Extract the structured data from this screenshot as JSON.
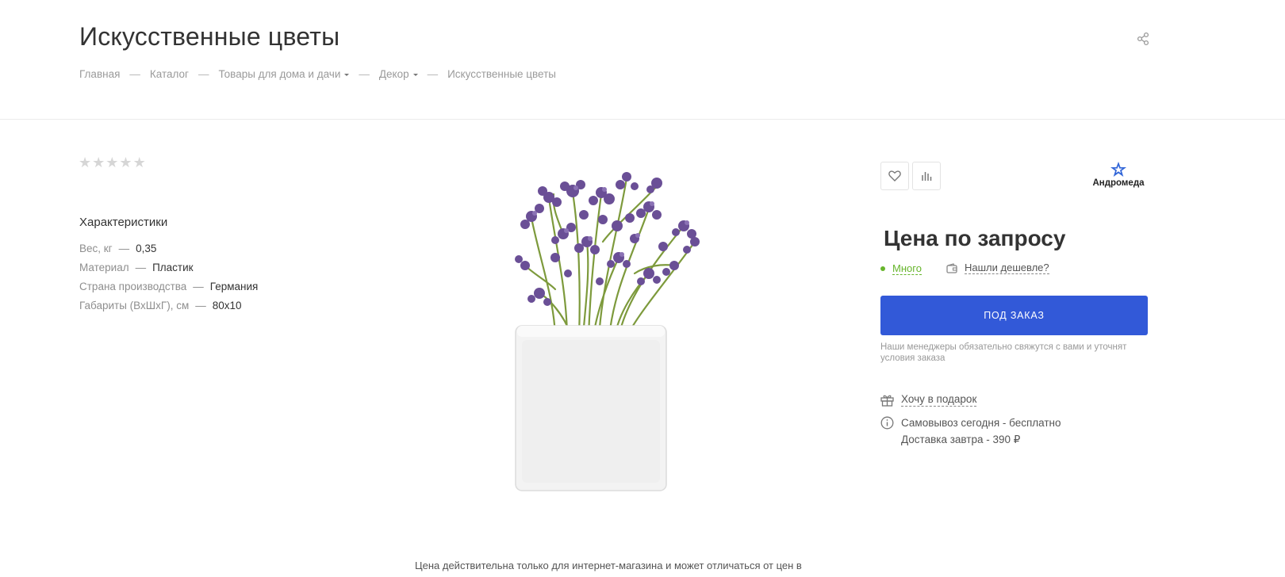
{
  "page": {
    "title": "Искусственные цветы"
  },
  "breadcrumb": [
    {
      "label": "Главная",
      "has_dropdown": false
    },
    {
      "label": "Каталог",
      "has_dropdown": false
    },
    {
      "label": "Товары для дома и дачи",
      "has_dropdown": true
    },
    {
      "label": "Декор",
      "has_dropdown": true
    },
    {
      "label": "Искусственные цветы",
      "has_dropdown": false
    }
  ],
  "breadcrumb_separator": "—",
  "rating": {
    "stars_filled": 0,
    "stars_total": 5,
    "star_glyph": "★"
  },
  "specs": {
    "title": "Характеристики",
    "separator": "—",
    "items": [
      {
        "name": "Вес, кг",
        "value": "0,35"
      },
      {
        "name": "Материал",
        "value": "Пластик"
      },
      {
        "name": "Страна производства",
        "value": "Германия"
      },
      {
        "name": "Габариты (ВхШхГ), см",
        "value": "80x10"
      }
    ]
  },
  "actions": {
    "favorite_icon": "heart-icon",
    "compare_icon": "bar-chart-icon",
    "share_icon": "share-icon"
  },
  "brand": {
    "name": "Андромеда",
    "logo_color": "#3266d8"
  },
  "offer": {
    "price_text": "Цена по запросу",
    "stock_label": "Много",
    "cheaper_label": "Нашли дешевле?",
    "order_button_label": "Под заказ",
    "order_note": "Наши менеджеры обязательно свяжутся с вами и уточнят условия заказа",
    "gift_label": "Хочу в подарок",
    "delivery_lines": [
      "Самовывоз сегодня - бесплатно",
      "Доставка завтра - 390 ₽"
    ]
  },
  "footer_note": "Цена действительна только для интернет-магазина и может отличаться от цен в",
  "colors": {
    "accent": "#3259d8",
    "stock_green": "#67b52c",
    "flower_purple": "#6a4f96",
    "stem_green": "#7d9a3c",
    "pot_white": "#f3f3f3"
  }
}
